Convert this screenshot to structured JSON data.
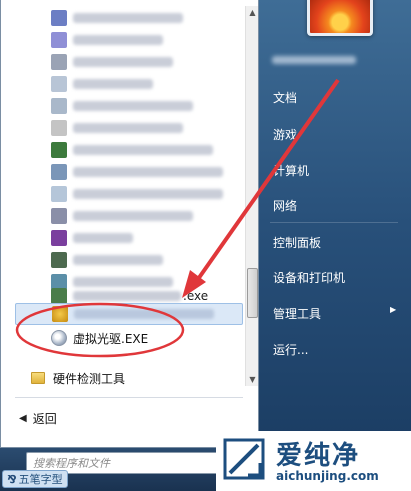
{
  "program_list": {
    "highlighted_suffix": ".exe",
    "sub_item_label": "虚拟光驱.EXE",
    "folder_label": "硬件检测工具"
  },
  "back_label": "返回",
  "search": {
    "placeholder": "搜索程序和文件"
  },
  "right_menu": {
    "items": [
      {
        "label": "文档"
      },
      {
        "label": "游戏"
      },
      {
        "label": "计算机"
      },
      {
        "label": "网络"
      },
      {
        "label": "控制面板"
      },
      {
        "label": "设备和打印机"
      },
      {
        "label": "管理工具"
      },
      {
        "label": "运行..."
      }
    ]
  },
  "ime": {
    "label": "五笔字型"
  },
  "watermark": {
    "cn": "爱纯净",
    "en": "aichunjing.com"
  },
  "colors": {
    "accent_red": "#e0373a",
    "menu_blue": "#28507a",
    "logo_blue": "#1d4e7f"
  }
}
